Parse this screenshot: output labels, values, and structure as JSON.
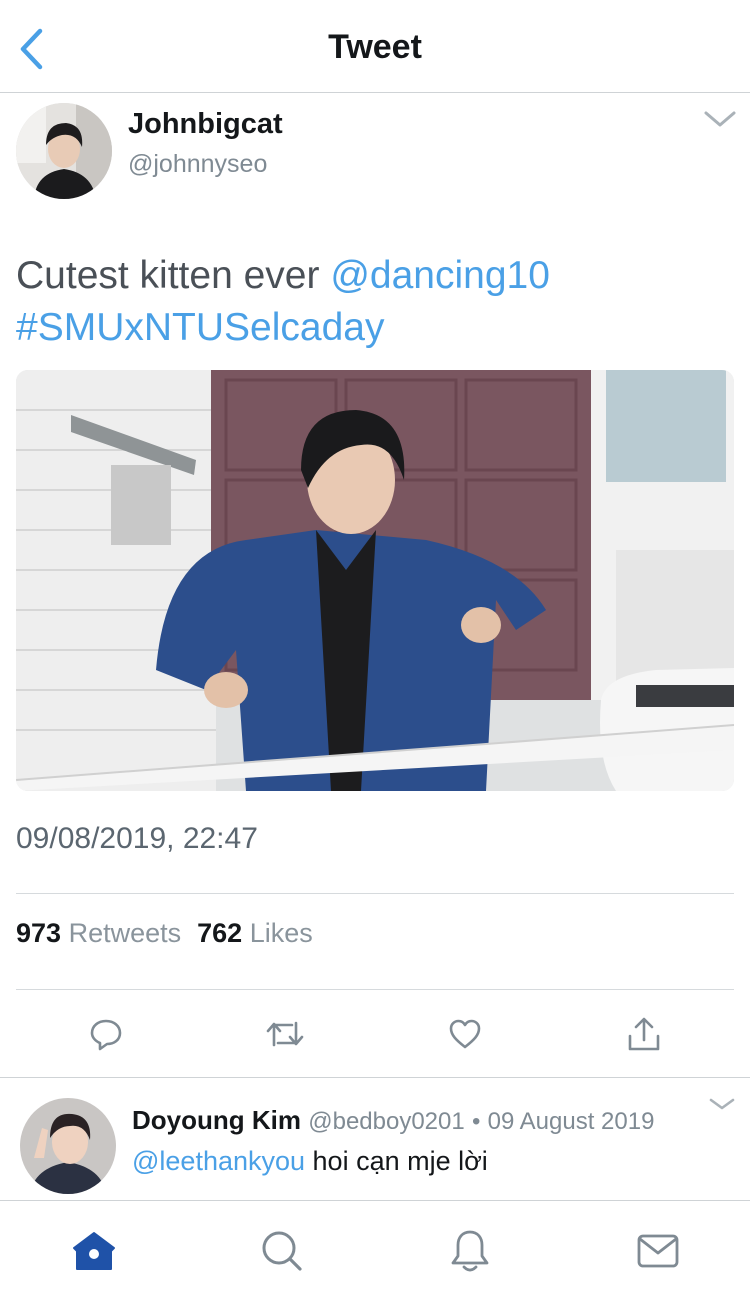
{
  "header": {
    "title": "Tweet"
  },
  "tweet": {
    "author_name": "Johnbigcat",
    "author_handle": "@johnnyseo",
    "text_prefix": "Cutest kitten ever ",
    "mention": "@dancing10",
    "hashtag": "#SMUxNTUSelcaday",
    "timestamp": "09/08/2019, 22:47",
    "retweets_count": "973",
    "retweets_label": "Retweets",
    "likes_count": "762",
    "likes_label": "Likes"
  },
  "actions": [
    "reply-icon",
    "retweet-icon",
    "like-icon",
    "share-icon"
  ],
  "reply": {
    "author_name": "Doyoung Kim",
    "author_handle": "@bedboy0201",
    "separator": "•",
    "date": "09 August 2019",
    "mention": "@leethankyou",
    "text": " hoi cạn mje lời"
  },
  "tabbar": [
    "home-icon",
    "search-icon",
    "notifications-icon",
    "messages-icon"
  ],
  "colors": {
    "accent": "#4aa0e6",
    "active_tab": "#1f52a8",
    "text": "#14171a",
    "muted": "#7f8a93"
  }
}
